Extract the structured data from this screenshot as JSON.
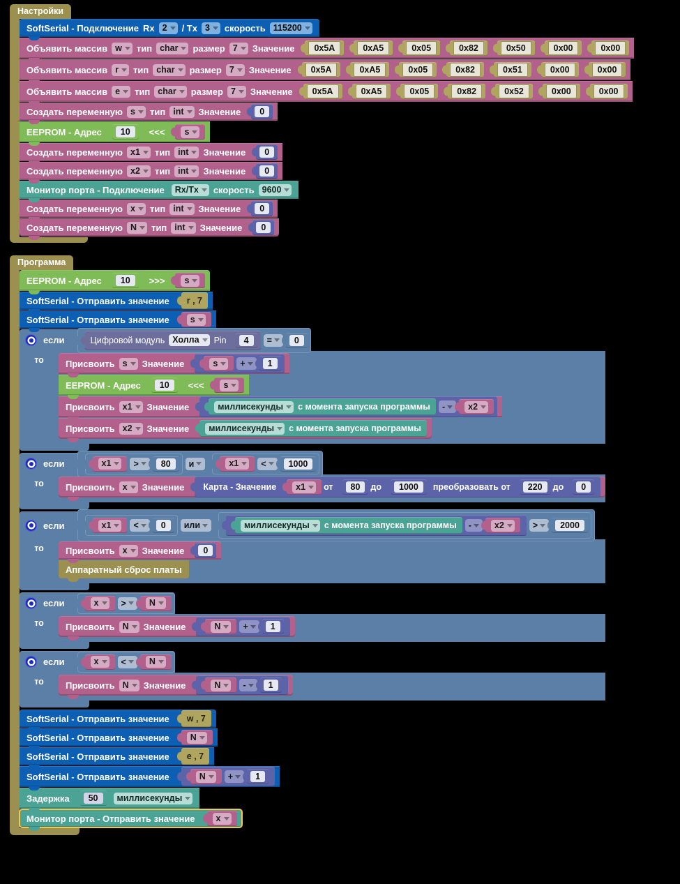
{
  "sections": {
    "settings_tab": "Настройки",
    "program_tab": "Программа"
  },
  "labels": {
    "softserial_connect": "SoftSerial - Подключение",
    "rx": "Rx",
    "tx_sep": "/ Tx",
    "speed": "скорость",
    "declare_array": "Объявить массив",
    "type": "тип",
    "size": "размер",
    "value": "Значение",
    "create_var": "Создать переменную",
    "eeprom_addr": "EEPROM - Адрес",
    "write_arrow": "<<<",
    "read_arrow": ">>>",
    "port_monitor_connect": "Монитор порта - Подключение",
    "softserial_send": "SoftSerial - Отправить значение",
    "if": "если",
    "then": "то",
    "digital_module": "Цифровой модуль",
    "pin": "Pin",
    "assign": "Присвоить",
    "millis": "миллисекунды",
    "since_start": "с момента запуска программы",
    "map_value": "Карта - Значение",
    "from": "от",
    "to": "до",
    "convert_from": "преобразовать от",
    "board_reset": "Аппаратный сброс платы",
    "delay": "Задержка",
    "port_monitor_send": "Монитор порта - Отправить значение"
  },
  "settings": {
    "softserial": {
      "rx": "2",
      "tx": "3",
      "speed": "115200"
    },
    "arrays": [
      {
        "name": "w",
        "type": "char",
        "size": "7",
        "values": [
          "0x5A",
          "0xA5",
          "0x05",
          "0x82",
          "0x50",
          "0x00",
          "0x00"
        ]
      },
      {
        "name": "r",
        "type": "char",
        "size": "7",
        "values": [
          "0x5A",
          "0xA5",
          "0x05",
          "0x82",
          "0x51",
          "0x00",
          "0x00"
        ]
      },
      {
        "name": "e",
        "type": "char",
        "size": "7",
        "values": [
          "0x5A",
          "0xA5",
          "0x05",
          "0x82",
          "0x52",
          "0x00",
          "0x00"
        ]
      }
    ],
    "var_s": {
      "name": "s",
      "type": "int",
      "value": "0"
    },
    "eeprom_write": {
      "address": "10",
      "var": "s"
    },
    "var_x1": {
      "name": "x1",
      "type": "int",
      "value": "0"
    },
    "var_x2": {
      "name": "x2",
      "type": "int",
      "value": "0"
    },
    "port_monitor": {
      "port": "Rx/Tx",
      "speed": "9600"
    },
    "var_x": {
      "name": "x",
      "type": "int",
      "value": "0"
    },
    "var_N": {
      "name": "N",
      "type": "int",
      "value": "0"
    }
  },
  "program": {
    "eeprom_read": {
      "address": "10",
      "var": "s"
    },
    "send_r": "r , 7",
    "send_s": "s",
    "if1": {
      "cond": {
        "module": "Холла",
        "pin": "4",
        "op": "=",
        "value": "0"
      },
      "assign_s": {
        "var": "s",
        "a": "s",
        "op": "+",
        "b": "1"
      },
      "eeprom_write": {
        "address": "10",
        "var": "s"
      },
      "assign_x1": {
        "var": "x1",
        "op": "-",
        "b": "x2"
      },
      "assign_x2": {
        "var": "x2"
      }
    },
    "if2": {
      "left": {
        "a": "x1",
        "op": ">",
        "b": "80"
      },
      "joiner": "и",
      "right": {
        "a": "x1",
        "op": "<",
        "b": "1000"
      },
      "assign_x": {
        "var": "x",
        "src": "x1",
        "from": "80",
        "to": "1000",
        "conv_from": "220",
        "conv_to": "0"
      }
    },
    "if3": {
      "left": {
        "a": "x1",
        "op": "<",
        "b": "0"
      },
      "joiner": "или",
      "right": {
        "op": "-",
        "b": "x2",
        "cmp": ">",
        "value": "2000"
      },
      "assign_x": {
        "var": "x",
        "value": "0"
      },
      "reset": "Аппаратный сброс платы"
    },
    "if4": {
      "cond": {
        "a": "x",
        "op": ">",
        "b": "N"
      },
      "assign_N": {
        "var": "N",
        "a": "N",
        "op": "+",
        "b": "1"
      }
    },
    "if5": {
      "cond": {
        "a": "x",
        "op": "<",
        "b": "N"
      },
      "assign_N": {
        "var": "N",
        "a": "N",
        "op": "-",
        "b": "1"
      }
    },
    "send_w": "w , 7",
    "send_N": "N",
    "send_e": "e , 7",
    "send_N_plus": {
      "a": "N",
      "op": "+",
      "b": "1"
    },
    "delay": {
      "value": "50",
      "unit": "миллисекунды"
    },
    "monitor_send": {
      "var": "x"
    }
  },
  "colors": {
    "blue": "#0d5fb4",
    "pink": "#b2618c",
    "green": "#7fbb56",
    "teal": "#4ba395",
    "slate": "#5b7fa6",
    "purple": "#5c63a8",
    "khaki": "#9c9050",
    "selection": "#f2c94c"
  }
}
